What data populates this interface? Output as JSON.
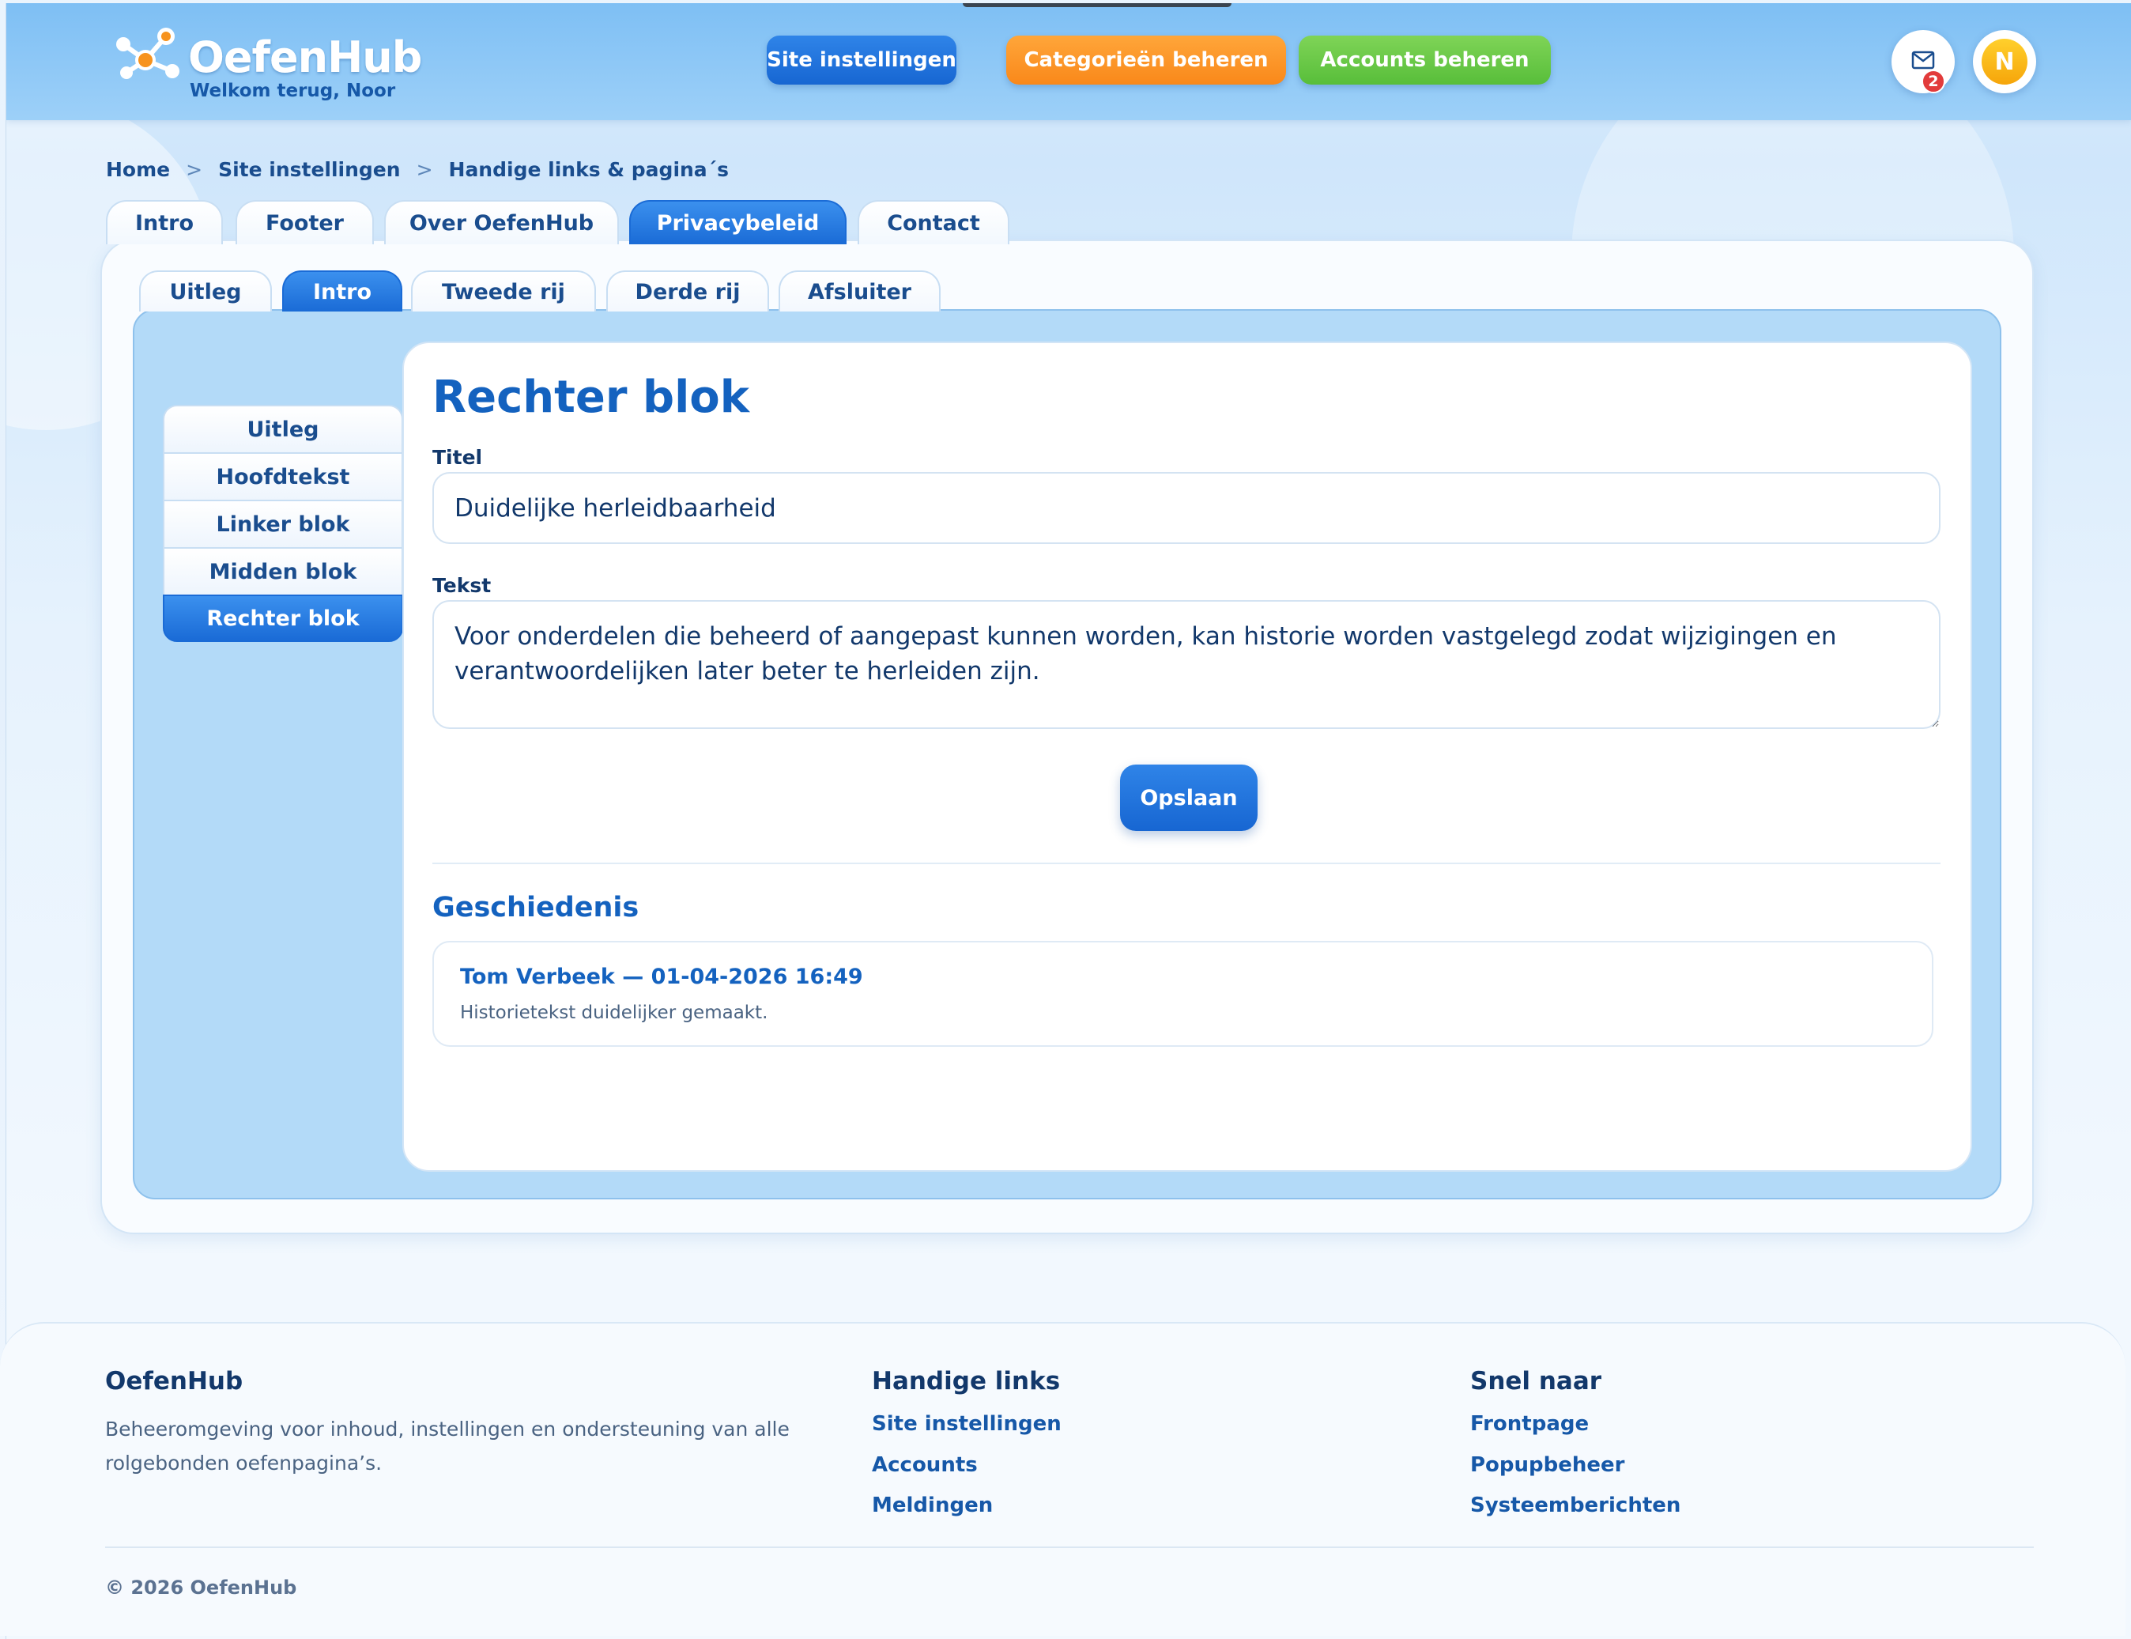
{
  "header": {
    "logo_text": "OefenHub",
    "welcome": "Welkom terug, Noor",
    "nav": {
      "site_settings": "Site instellingen",
      "categories": "Categorieën beheren",
      "accounts": "Accounts beheren"
    },
    "mail_badge": "2",
    "avatar_initial": "N"
  },
  "breadcrumb": {
    "items": [
      "Home",
      "Site instellingen",
      "Handige links & pagina´s"
    ],
    "separator": ">"
  },
  "page_tabs": [
    "Intro",
    "Footer",
    "Over OefenHub",
    "Privacybeleid",
    "Contact"
  ],
  "page_tabs_active": "Privacybeleid",
  "section_tabs": [
    "Uitleg",
    "Intro",
    "Tweede rij",
    "Derde rij",
    "Afsluiter"
  ],
  "section_tabs_active": "Intro",
  "side_menu": [
    "Uitleg",
    "Hoofdtekst",
    "Linker blok",
    "Midden blok",
    "Rechter blok"
  ],
  "side_menu_active": "Rechter blok",
  "editor": {
    "title": "Rechter blok",
    "titel_label": "Titel",
    "titel_value": "Duidelijke herleidbaarheid",
    "tekst_label": "Tekst",
    "tekst_value": "Voor onderdelen die beheerd of aangepast kunnen worden, kan historie worden vastgelegd zodat wijzigingen en verantwoordelijken later beter te herleiden zijn.",
    "save_label": "Opslaan"
  },
  "history": {
    "title": "Geschiedenis",
    "entries": [
      {
        "heading": "Tom Verbeek — 01-04-2026 16:49",
        "text": "Historietekst duidelijker gemaakt."
      }
    ]
  },
  "footer": {
    "col1": {
      "title": "OefenHub",
      "text": "Beheeromgeving voor inhoud, instellingen en ondersteuning van alle rolgebonden oefenpagina’s."
    },
    "col2": {
      "title": "Handige links",
      "links": [
        "Site instellingen",
        "Accounts",
        "Meldingen"
      ]
    },
    "col3": {
      "title": "Snel naar",
      "links": [
        "Frontpage",
        "Popupbeheer",
        "Systeemberichten"
      ]
    },
    "copyright": "© 2026 OefenHub"
  },
  "colors": {
    "primary_blue": "#1a6bd6",
    "orange": "#f9881a",
    "green": "#58be3a",
    "heading_blue": "#1462bf",
    "badge_red": "#e23b3b",
    "avatar_yellow": "#f6a50a"
  },
  "icons": [
    "logo-molecule-icon",
    "mail-icon"
  ]
}
